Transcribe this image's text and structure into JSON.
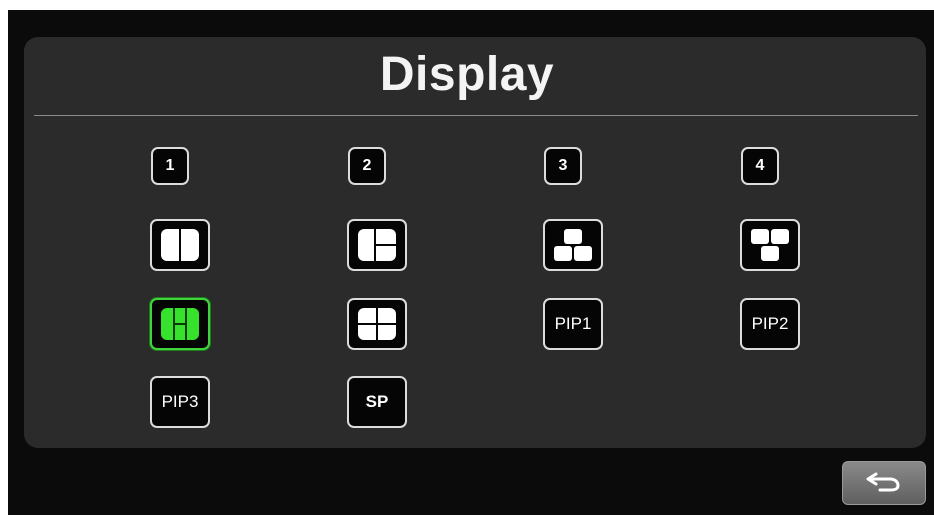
{
  "app": {
    "title": "Display"
  },
  "grid": {
    "row1": [
      {
        "label": "1",
        "icon": "channel-1"
      },
      {
        "label": "2",
        "icon": "channel-2"
      },
      {
        "label": "3",
        "icon": "channel-3"
      },
      {
        "label": "4",
        "icon": "channel-4"
      }
    ],
    "row2": [
      {
        "icon": "split-2-vertical-icon"
      },
      {
        "icon": "split-3-left-big-icon"
      },
      {
        "icon": "split-3-top-one-bottom-two-icon"
      },
      {
        "icon": "split-3-top-two-bottom-one-icon"
      }
    ],
    "row3": [
      {
        "icon": "split-3-column-icon",
        "selected": true
      },
      {
        "icon": "quad-split-icon"
      },
      {
        "label": "PIP1"
      },
      {
        "label": "PIP2"
      }
    ],
    "row4": [
      {
        "label": "PIP3"
      },
      {
        "label": "SP"
      }
    ]
  },
  "colors": {
    "panel_bg": "#2b2b2b",
    "screen_bg": "#0b0b0b",
    "selected_fill": "#37e22f",
    "button_border": "#dcdcdc"
  },
  "footer": {
    "back_icon": "return-arrow-icon"
  }
}
